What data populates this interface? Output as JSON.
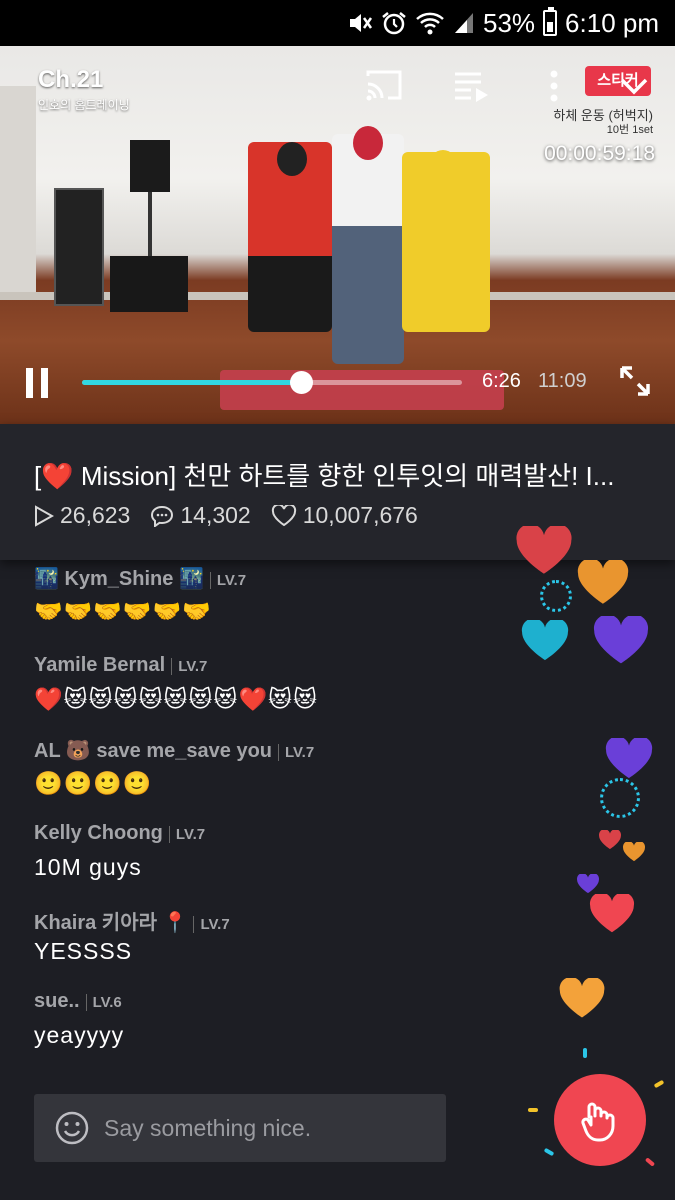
{
  "status_bar": {
    "battery": "53%",
    "time": "6:10 pm",
    "icons": [
      "mute-icon",
      "alarm-icon",
      "wifi-icon",
      "signal-icon",
      "battery-icon"
    ]
  },
  "video": {
    "channel_logo": "Ch.21",
    "channel_subtitle": "인호의 홈트레이닝",
    "sticker_label": "스티커",
    "exercise_name": "하체 운동 (허벅지)",
    "exercise_sets": "10번 1set",
    "timer": "00:00:59:18",
    "current_time": "6:26",
    "total_time": "11:09",
    "progress": 0.577,
    "buffered": 0.64,
    "icons": [
      "cast-icon",
      "playlist-icon",
      "more-icon",
      "chevron-down-icon",
      "pause-icon",
      "fullscreen-icon"
    ]
  },
  "info": {
    "title": "[❤️ Mission] 천만 하트를 향한 인투잇의 매력발산! I...",
    "plays": "26,623",
    "comments": "14,302",
    "hearts": "10,007,676"
  },
  "chat": {
    "messages": [
      {
        "name": "🌃 Kym_Shine 🌃",
        "level": "LV.7",
        "text": "🤝🤝🤝🤝🤝🤝"
      },
      {
        "name": "Yamile Bernal",
        "level": "LV.7",
        "text": "❤️😻😻😻😻😻😻😻❤️😻😻"
      },
      {
        "name": "AL 🐻 save me_save you",
        "level": "LV.7",
        "text": "🙂🙂🙂🙂"
      },
      {
        "name": "Kelly Choong",
        "level": "LV.7",
        "text": "10M guys"
      },
      {
        "name": "Khaira 키아라 📍",
        "level": "LV.7",
        "text": "YESSSS"
      },
      {
        "name": "sue..",
        "level": "LV.6",
        "text": "yeayyyy"
      }
    ]
  },
  "input": {
    "placeholder": "Say something nice."
  },
  "colors": {
    "accent": "#32d7e2",
    "like_button": "#f04651",
    "background": "#1d1e24"
  }
}
